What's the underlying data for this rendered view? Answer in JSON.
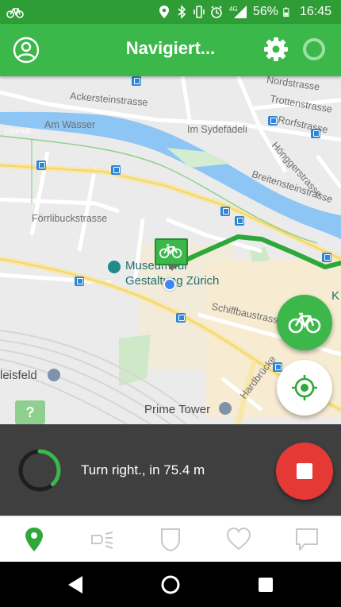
{
  "status_bar": {
    "left_icon": "bicycle-icon",
    "icons": [
      "location-pin-icon",
      "bluetooth-icon",
      "vibrate-icon",
      "alarm-icon",
      "network-4g-icon",
      "battery-icon"
    ],
    "network_label": "4G",
    "battery_percent": "56%",
    "time": "16:45"
  },
  "app_bar": {
    "title": "Navigiert...",
    "left_icon": "profile-icon",
    "right_icons": [
      "gear-icon",
      "sync-ring-icon"
    ]
  },
  "map": {
    "street_labels": [
      "Ackersteinstrasse",
      "Am Wasser",
      "Im Sydefädeli",
      "Nordstrasse",
      "Trottenstrasse",
      "Rorfstrasse",
      "Hönggerstrasse",
      "Breitensteinstrasse",
      "Förrlibuckstrasse",
      "Schiffbaustrasse",
      "Hardbrücke",
      "Limmat"
    ],
    "poi": {
      "museum_line1": "Museum für",
      "museum_line2": "Gestaltung Zürich",
      "prime_tower": "Prime Tower",
      "leisfeld": "leisfeld",
      "k_label": "K",
      "help_marker": "?"
    },
    "marker_icon": "bicycle-icon"
  },
  "fabs": {
    "bike_icon": "bicycle-icon",
    "locate_icon": "crosshair-locate-icon"
  },
  "navigation": {
    "instruction": "Turn right., in 75.4 m",
    "progress": 0.38,
    "stop_icon": "stop-icon"
  },
  "tabs": [
    {
      "name": "map",
      "icon": "map-pin-icon",
      "active": true
    },
    {
      "name": "light",
      "icon": "bike-light-icon",
      "active": false
    },
    {
      "name": "shield",
      "icon": "shield-icon",
      "active": false
    },
    {
      "name": "favorites",
      "icon": "heart-icon",
      "active": false
    },
    {
      "name": "messages",
      "icon": "chat-bubble-icon",
      "active": false
    }
  ],
  "colors": {
    "brand_green": "#3cb84a",
    "status_green": "#2e9d35",
    "panel_dark": "#3f3f3f",
    "stop_red": "#e53935",
    "route_green": "#2ea83a",
    "user_dot": "#4285f4"
  },
  "system_nav": [
    "back-icon",
    "home-icon",
    "recents-icon"
  ]
}
